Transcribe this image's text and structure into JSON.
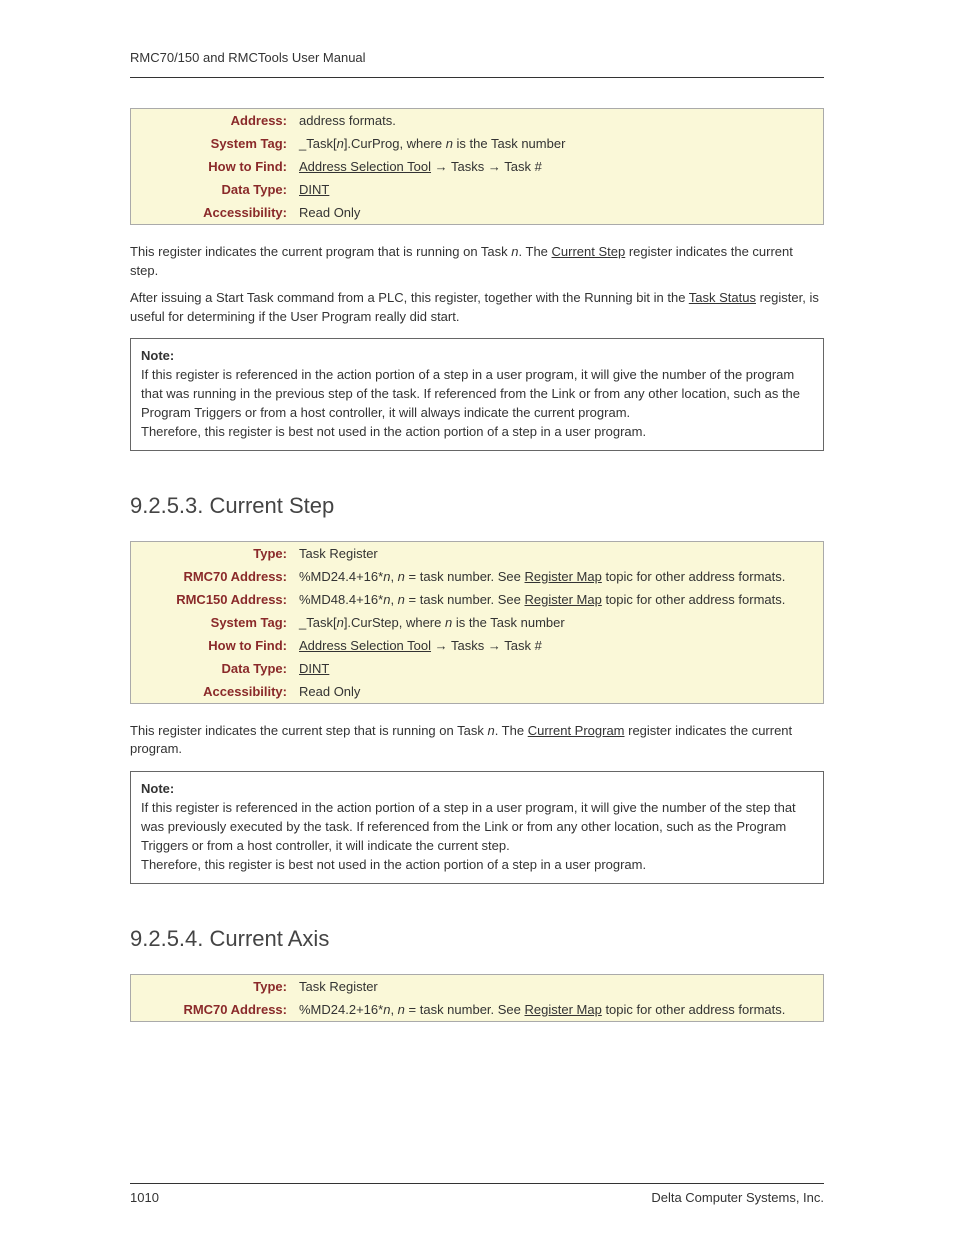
{
  "header": "RMC70/150 and RMCTools User Manual",
  "table1": {
    "rows": [
      {
        "label": "Address:",
        "value_pre": "address formats."
      },
      {
        "label": "System Tag:",
        "value_pre": "_Task[",
        "value_n": "n",
        "value_post": "].CurProg, where ",
        "value_n2": "n",
        "value_end": " is the Task number"
      },
      {
        "label": "How to Find:",
        "link1": "Address Selection Tool",
        "arrow": " → Tasks → Task #"
      },
      {
        "label": "Data Type:",
        "link_val": "DINT"
      },
      {
        "label": "Accessibility:",
        "plain": "Read Only"
      }
    ]
  },
  "body1": {
    "p1_a": "This register indicates the current program that is running on Task ",
    "p1_n": "n",
    "p1_b": ". The ",
    "p1_link": "Current Step",
    "p1_c": " register indicates the current step.",
    "p2_a": "After issuing a Start Task command from a PLC, this register, together with the Running bit in the ",
    "p2_link": "Task Status",
    "p2_b": " register, is useful for determining if the User Program really did start."
  },
  "note1": {
    "title": "Note:",
    "p1": "If this register is referenced in the action portion of a step in a user program, it will give the number of the program that was running in the previous step of the task. If referenced from the Link or from any other location, such as the Program Triggers or from a host controller, it will always indicate the current program.",
    "p2": "Therefore, this register is best not used in the action portion of a step in a user program."
  },
  "section2": {
    "heading": "9.2.5.3. Current Step",
    "rows": {
      "type_label": "Type:",
      "type_value": "Task Register",
      "r70_label": "RMC70 Address:",
      "r70_pre": "%MD24.4+16*",
      "r70_n": "n",
      "r70_mid": ", ",
      "r70_n2": "n",
      "r70_eq": " = task number. See ",
      "r70_link": "Register Map",
      "r70_post": " topic for other address formats.",
      "r150_label": "RMC150 Address:",
      "r150_pre": "%MD48.4+16*",
      "r150_n": "n",
      "r150_mid": ", ",
      "r150_n2": "n",
      "r150_eq": " = task number. See ",
      "r150_link": "Register Map",
      "r150_post": " topic for other address formats.",
      "tag_label": "System Tag:",
      "tag_pre": "_Task[",
      "tag_n": "n",
      "tag_mid": "].CurStep, where ",
      "tag_n2": "n",
      "tag_end": " is the Task number",
      "find_label": "How to Find:",
      "find_link": "Address Selection Tool",
      "find_post": " → Tasks → Task #",
      "dtype_label": "Data Type:",
      "dtype_link": "DINT",
      "acc_label": "Accessibility:",
      "acc_val": "Read Only"
    },
    "body": {
      "p1_a": "This register indicates the current step that is running on Task ",
      "p1_n": "n",
      "p1_b": ". The ",
      "p1_link": "Current Program",
      "p1_c": " register indicates the current program."
    },
    "note": {
      "title": "Note:",
      "p1": "If this register is referenced in the action portion of a step in a user program, it will give the number of the step that was previously executed by the task. If referenced from the Link or from any other location, such as the Program Triggers or from a host controller, it will indicate the current step.",
      "p2": "Therefore, this register is best not used in the action portion of a step in a user program."
    }
  },
  "section3": {
    "heading": "9.2.5.4. Current Axis",
    "rows": {
      "type_label": "Type:",
      "type_value": "Task Register",
      "r70_label": "RMC70 Address:",
      "r70_pre": "%MD24.2+16*",
      "r70_n": "n",
      "r70_mid": ", ",
      "r70_n2": "n",
      "r70_eq": " = task number. See ",
      "r70_link": "Register Map",
      "r70_post": " topic for other address formats."
    }
  },
  "footer": {
    "page": "1010",
    "right": "Delta Computer Systems, Inc."
  }
}
